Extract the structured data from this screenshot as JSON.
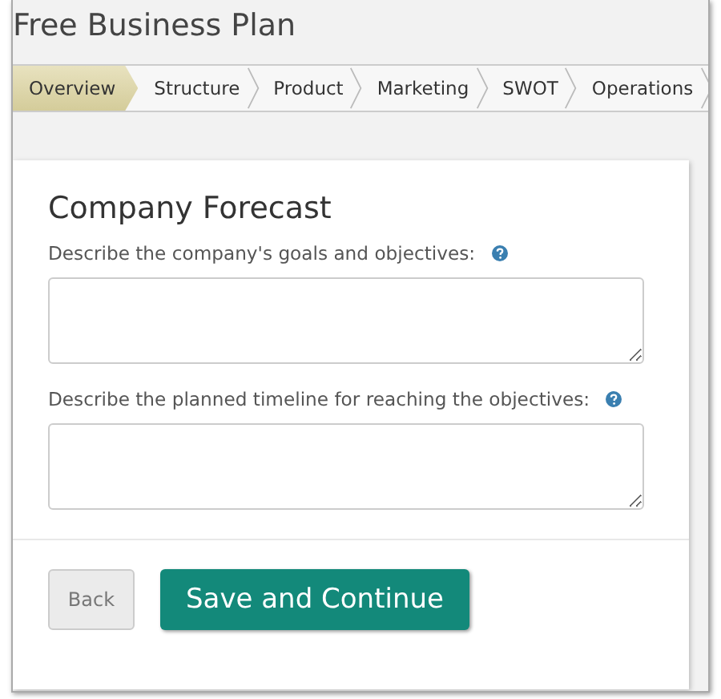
{
  "title": "Free Business Plan",
  "steps": [
    {
      "label": "Overview",
      "selected": true
    },
    {
      "label": "Structure",
      "selected": false
    },
    {
      "label": "Product",
      "selected": false
    },
    {
      "label": "Marketing",
      "selected": false
    },
    {
      "label": "SWOT",
      "selected": false
    },
    {
      "label": "Operations",
      "selected": false
    }
  ],
  "heading": "Company Forecast",
  "fields": [
    {
      "label": "Describe the company's goals and objectives:"
    },
    {
      "label": "Describe the planned timeline for reaching the objectives:"
    }
  ],
  "buttons": {
    "back": "Back",
    "save": "Save and Continue"
  }
}
